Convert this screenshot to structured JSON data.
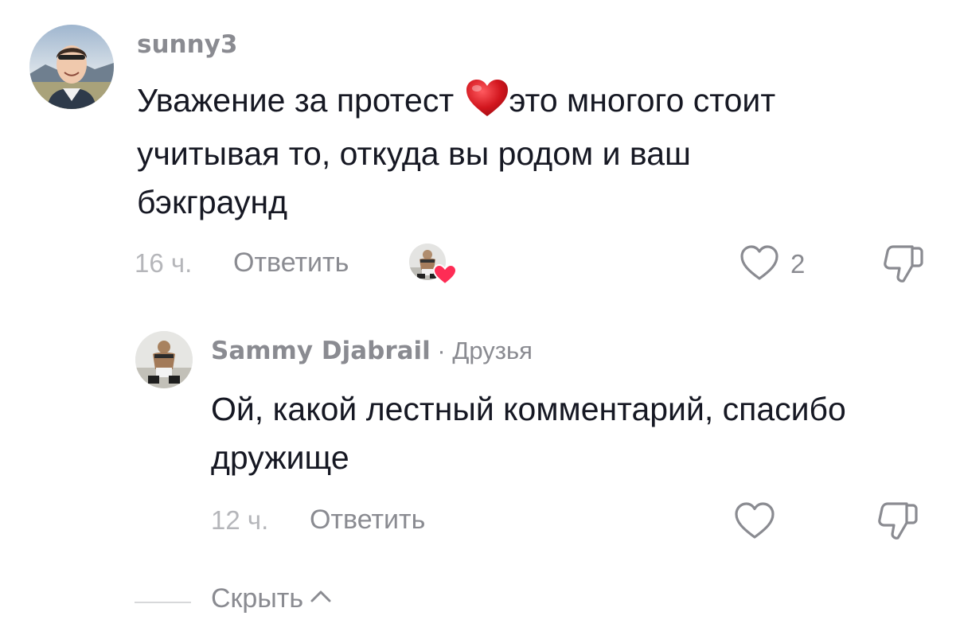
{
  "comment": {
    "username": "sunny3",
    "text_line1_before": "Уважение за протест ",
    "text_line1_after": "это многого стоит",
    "text_line2": "учитывая то, откуда вы родом и ваш",
    "text_line3": "бэкграунд",
    "time": "16 ч.",
    "reply_label": "Ответить",
    "like_count": "2",
    "inline_emoji": "red-heart-emoji"
  },
  "reply": {
    "username": "Sammy Djabrail",
    "separator": " · ",
    "relation": "Друзья",
    "text_line1": "Ой, какой лестный комментарий, спасибо",
    "text_line2": "дружище",
    "time": "12 ч.",
    "reply_label": "Ответить"
  },
  "collapse": {
    "label": "Скрыть"
  },
  "icons": {
    "like": "heart-outline-icon",
    "dislike": "thumbs-down-icon",
    "collapse": "chevron-up-icon",
    "liked_by_creator": "creator-liked-badge"
  },
  "colors": {
    "text": "#161823",
    "muted": "#8a8b91",
    "time": "#b5b6ba",
    "heart": "#fe2c55",
    "emoji_heart": "#d2161e"
  }
}
